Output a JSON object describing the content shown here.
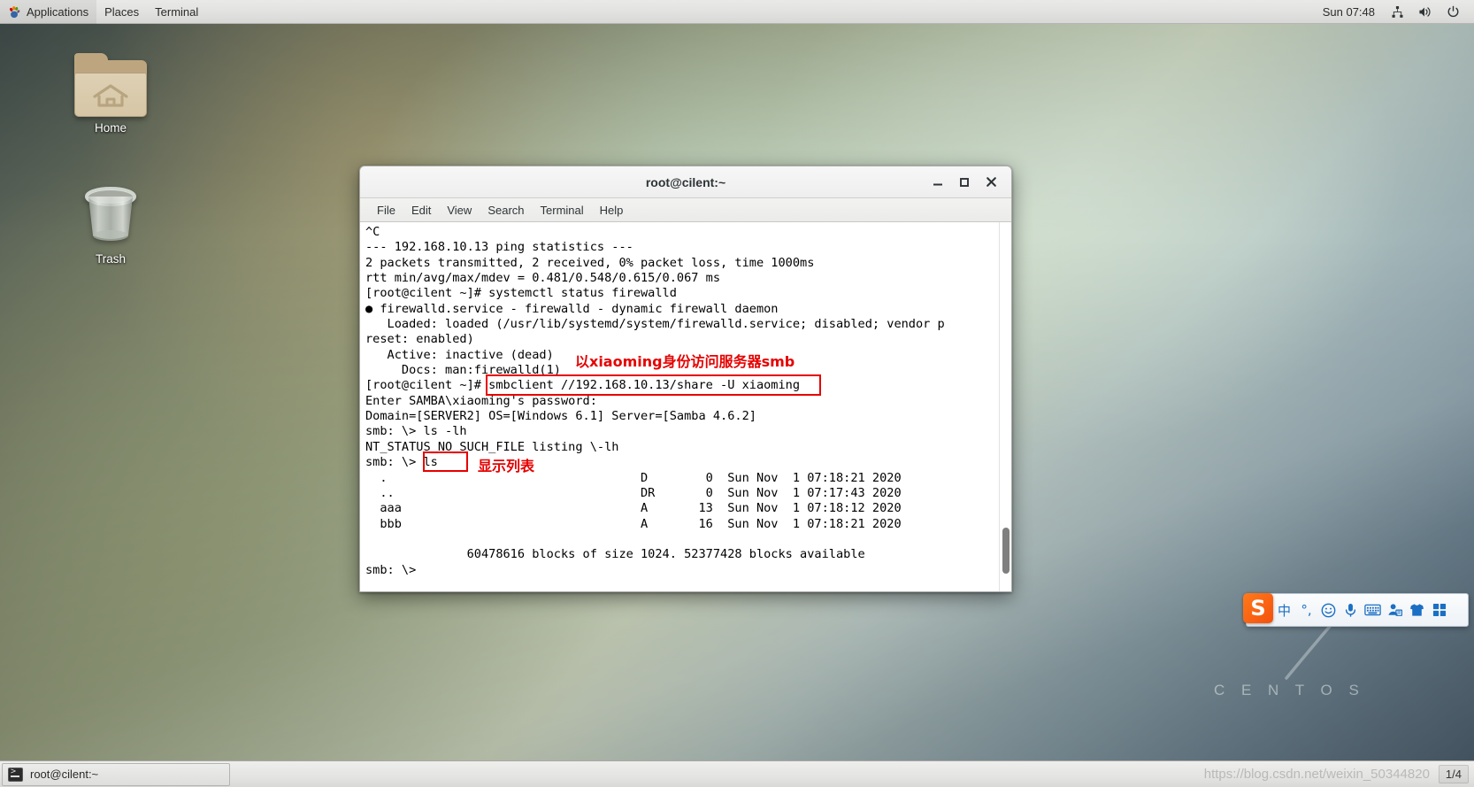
{
  "top_panel": {
    "applications_label": "Applications",
    "places_label": "Places",
    "terminal_label": "Terminal",
    "clock": "Sun 07:48",
    "icons": [
      "network-icon",
      "volume-icon",
      "power-icon"
    ]
  },
  "desktop": {
    "icons": [
      {
        "name": "home",
        "label": "Home",
        "icon": "folder-home-icon"
      },
      {
        "name": "trash",
        "label": "Trash",
        "icon": "trash-can-icon"
      }
    ],
    "branding": "C E N T O S"
  },
  "terminal": {
    "title": "root@cilent:~",
    "controls": {
      "minimize": "–",
      "maximize": "□",
      "close": "✕"
    },
    "menus": [
      "File",
      "Edit",
      "View",
      "Search",
      "Terminal",
      "Help"
    ],
    "lines": [
      "^C",
      "--- 192.168.10.13 ping statistics ---",
      "2 packets transmitted, 2 received, 0% packet loss, time 1000ms",
      "rtt min/avg/max/mdev = 0.481/0.548/0.615/0.067 ms",
      "[root@cilent ~]# systemctl status firewalld",
      "● firewalld.service - firewalld - dynamic firewall daemon",
      "   Loaded: loaded (/usr/lib/systemd/system/firewalld.service; disabled; vendor p",
      "reset: enabled)",
      "   Active: inactive (dead)",
      "     Docs: man:firewalld(1)",
      "[root@cilent ~]# smbclient //192.168.10.13/share -U xiaoming",
      "Enter SAMBA\\xiaoming's password:",
      "Domain=[SERVER2] OS=[Windows 6.1] Server=[Samba 4.6.2]",
      "smb: \\> ls -lh",
      "NT_STATUS_NO_SUCH_FILE listing \\-lh",
      "smb: \\> ls",
      "  .                                   D        0  Sun Nov  1 07:18:21 2020",
      "  ..                                  DR       0  Sun Nov  1 07:17:43 2020",
      "  aaa                                 A       13  Sun Nov  1 07:18:12 2020",
      "  bbb                                 A       16  Sun Nov  1 07:18:21 2020",
      "",
      "              60478616 blocks of size 1024. 52377428 blocks available",
      "smb: \\> "
    ]
  },
  "annotations": [
    {
      "name": "smbclient-note",
      "text": "以xiaoming身份访问服务器smb"
    },
    {
      "name": "ls-note",
      "text": "显示列表"
    }
  ],
  "ime": {
    "name": "sogou-input-method",
    "logo": "S",
    "items": [
      {
        "name": "chinese-english-toggle",
        "glyph": "中"
      },
      {
        "name": "punctuation-toggle",
        "glyph": "°,"
      },
      {
        "name": "emoji-icon",
        "glyph": "☺"
      },
      {
        "name": "voice-input-icon",
        "glyph": "⚉"
      },
      {
        "name": "soft-keyboard-icon",
        "glyph": "⌨"
      },
      {
        "name": "user-account-icon",
        "glyph": "☻"
      },
      {
        "name": "skin-icon",
        "glyph": "♟"
      },
      {
        "name": "toolbox-icon",
        "glyph": "▦"
      }
    ]
  },
  "bottom_panel": {
    "task_label": "root@cilent:~",
    "watermark": "https://blog.csdn.net/weixin_50344820",
    "workspace": "1/4"
  }
}
